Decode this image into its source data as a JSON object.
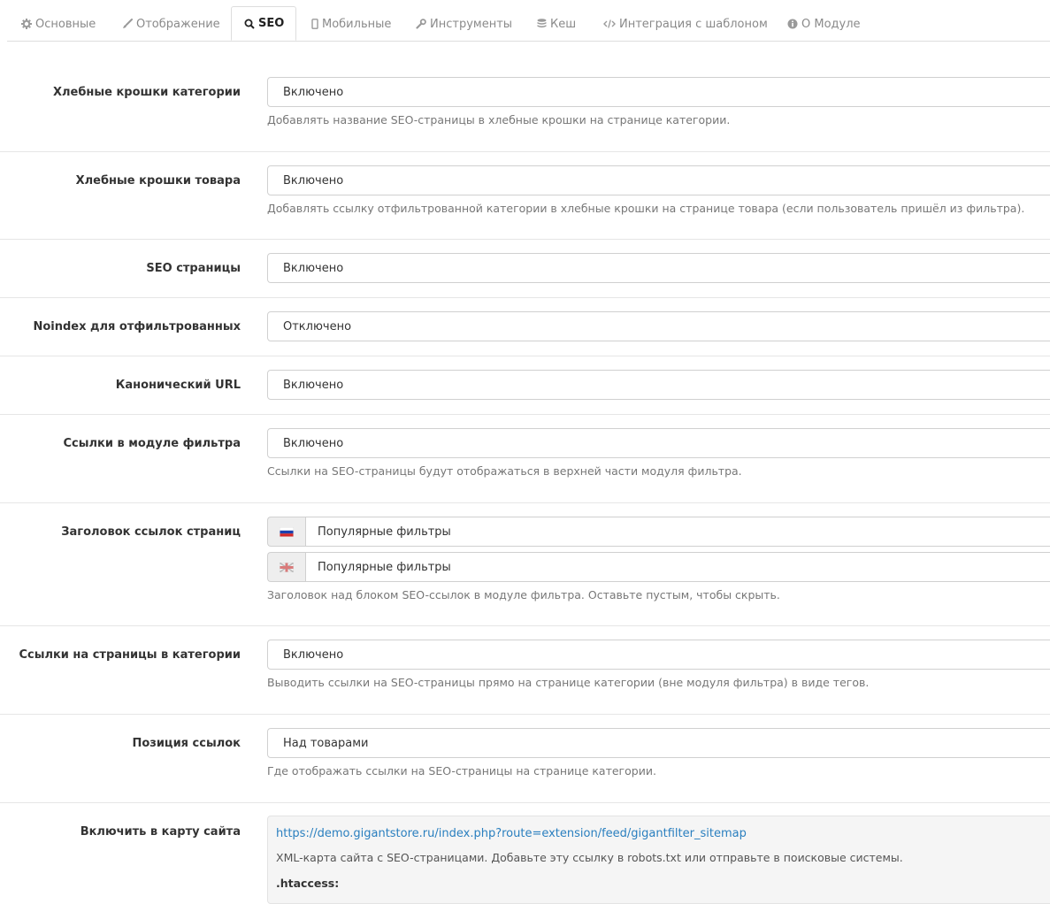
{
  "tabs": [
    {
      "label": "Основные",
      "icon": "gear-icon",
      "active": false
    },
    {
      "label": "Отображение",
      "icon": "brush-icon",
      "active": false
    },
    {
      "label": "SEO",
      "icon": "search-icon",
      "active": true
    },
    {
      "label": "Мобильные",
      "icon": "mobile-icon",
      "active": false
    },
    {
      "label": "Инструменты",
      "icon": "wrench-icon",
      "active": false
    },
    {
      "label": "Кеш",
      "icon": "database-icon",
      "active": false
    },
    {
      "label": "Интеграция с шаблоном",
      "icon": "code-icon",
      "active": false
    },
    {
      "label": "О Модуле",
      "icon": "info-icon",
      "active": false
    }
  ],
  "settings": {
    "cat_breadcrumbs": {
      "label": "Хлебные крошки категории",
      "value": "Включено",
      "help": "Добавлять название SEO-страницы в хлебные крошки на странице категории."
    },
    "product_breadcrumbs": {
      "label": "Хлебные крошки товара",
      "value": "Включено",
      "help": "Добавлять ссылку отфильтрованной категории в хлебные крошки на странице товара (если пользователь пришёл из фильтра)."
    },
    "seo_pages": {
      "label": "SEO страницы",
      "value": "Включено"
    },
    "noindex": {
      "label": "Noindex для отфильтрованных",
      "value": "Отключено"
    },
    "canonical": {
      "label": "Канонический URL",
      "value": "Включено"
    },
    "filter_links": {
      "label": "Ссылки в модуле фильтра",
      "value": "Включено",
      "help": "Ссылки на SEO-страницы будут отображаться в верхней части модуля фильтра."
    },
    "links_title": {
      "label": "Заголовок ссылок страниц",
      "values": [
        {
          "lang": "ru-flag-icon",
          "value": "Популярные фильтры"
        },
        {
          "lang": "en-flag-icon",
          "value": "Популярные фильтры"
        }
      ],
      "help": "Заголовок над блоком SEO-ссылок в модуле фильтра. Оставьте пустым, чтобы скрыть."
    },
    "category_links": {
      "label": "Ссылки на страницы в категории",
      "value": "Включено",
      "help": "Выводить ссылки на SEO-страницы прямо на странице категории (вне модуля фильтра) в виде тегов."
    },
    "links_position": {
      "label": "Позиция ссылок",
      "value": "Над товарами",
      "help": "Где отображать ссылки на SEO-страницы на странице категории."
    },
    "sitemap": {
      "label": "Включить в карту сайта",
      "url": "https://demo.gigantstore.ru/index.php?route=extension/feed/gigantfilter_sitemap",
      "text": "XML-карта сайта с SEO-страницами. Добавьте эту ссылку в robots.txt или отправьте в поисковые системы.",
      "htaccess_label": ".htaccess:"
    }
  },
  "colors": {
    "link": "#2a7fbf",
    "border": "#d0d0d0",
    "help_text": "#777777",
    "well_bg": "#f5f5f5"
  }
}
